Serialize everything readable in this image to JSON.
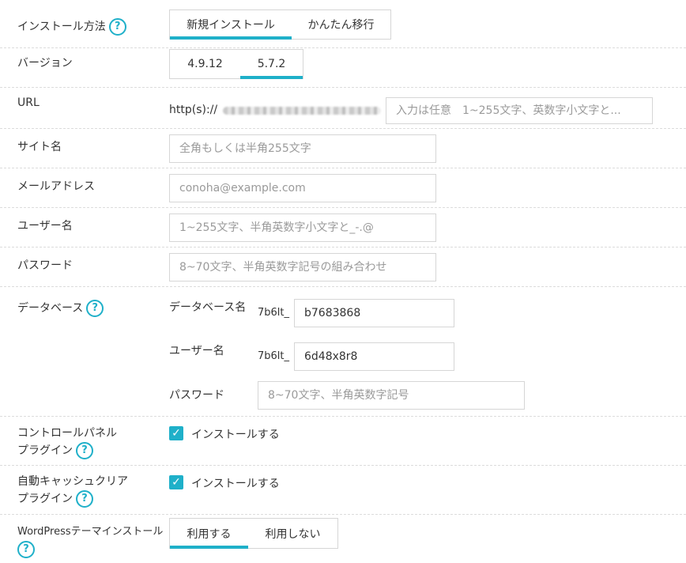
{
  "install_method": {
    "label": "インストール方法",
    "options": [
      "新規インストール",
      "かんたん移行"
    ],
    "selected": "新規インストール"
  },
  "version": {
    "label": "バージョン",
    "options": [
      "4.9.12",
      "5.7.2"
    ],
    "selected": "5.7.2"
  },
  "url": {
    "label": "URL",
    "prefix": "http(s)://",
    "placeholder": "入力は任意　1~255文字、英数字小文字と..."
  },
  "site_name": {
    "label": "サイト名",
    "placeholder": "全角もしくは半角255文字"
  },
  "email": {
    "label": "メールアドレス",
    "placeholder": "conoha@example.com"
  },
  "username": {
    "label": "ユーザー名",
    "placeholder": "1~255文字、半角英数字小文字と_-.@"
  },
  "password": {
    "label": "パスワード",
    "placeholder": "8~70文字、半角英数字記号の組み合わせ"
  },
  "database": {
    "label": "データベース",
    "db_name_label": "データベース名",
    "db_prefix": "7b6lt_",
    "db_name_value": "b7683868",
    "user_label": "ユーザー名",
    "user_prefix": "7b6lt_",
    "user_value": "6d48x8r8",
    "password_label": "パスワード",
    "password_placeholder": "8~70文字、半角英数字記号"
  },
  "control_panel_plugin": {
    "label_line1": "コントロールパネル",
    "label_line2": "プラグイン",
    "checkbox_label": "インストールする",
    "checked": true
  },
  "auto_cache_plugin": {
    "label_line1": "自動キャッシュクリア",
    "label_line2": "プラグイン",
    "checkbox_label": "インストールする",
    "checked": true
  },
  "theme_install": {
    "label": "WordPressテーマインストール",
    "options": [
      "利用する",
      "利用しない"
    ],
    "selected": "利用する"
  },
  "colors": {
    "accent": "#1fb0c9",
    "border": "#d6d6d6",
    "placeholder": "#9a9a9a"
  },
  "icons": {
    "help": "help-circle-icon",
    "check": "checkbox-check-icon"
  }
}
